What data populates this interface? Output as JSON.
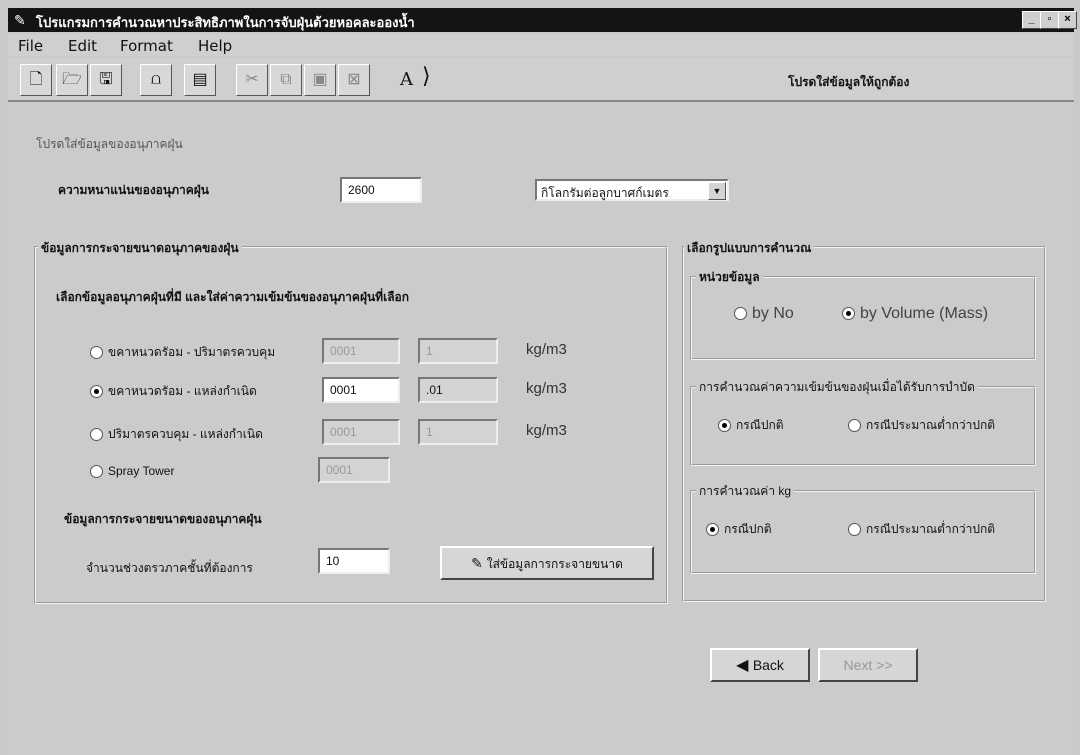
{
  "window": {
    "title": "โปรแกรมการคำนวณหาประสิทธิภาพในการจับฝุ่นด้วยหอคละอองน้ำ",
    "min": "_",
    "max": "▫",
    "close": "×"
  },
  "menu": [
    "File",
    "Edit",
    "Format",
    "Help"
  ],
  "toolbar": {
    "text_tool": "A",
    "status": "โปรดใส่ข้อมูลให้ถูกต้อง"
  },
  "main": {
    "header_label": "โปรดใส่ข้อมูลของอนุภาคฝุ่น",
    "density_label": "ความหนาแน่นของอนุภาคฝุ่น",
    "density_value": "2600",
    "density_unit": "กิโลกรัมต่อลูกบาศก์เมตร"
  },
  "distribution": {
    "legend": "ข้อมูลการกระจายขนาดอนุภาคของฝุ่น",
    "instruction": "เลือกข้อมูลอนุภาคฝุ่นที่มี และใส่ค่าความเข้มข้นของอนุภาคฝุ่นที่เลือก",
    "options": [
      {
        "label": "ขคาหนวดรัอม - ปริมาตรควบคุม",
        "value1": "0001",
        "value2": "1",
        "unit": "kg/m3"
      },
      {
        "label": "ขคาหนวดรัอม - แหล่งกำเนิด",
        "value1": "0001",
        "value2": ".01",
        "unit": "kg/m3"
      },
      {
        "label": "ปริมาตรควบคุม - แหล่งกำเนิด",
        "value1": "0001",
        "value2": "1",
        "unit": "kg/m3"
      },
      {
        "label": "Spray Tower",
        "value1": "0001"
      }
    ],
    "sub_label": "ข้อมูลการกระจายขนาดของอนุภาคฝุ่น",
    "count_label": "จำนวนช่วงตรวภาคชั้นที่ต้องการ",
    "count_value": "10",
    "enter_button": "ใส่ข้อมูลการกระจายขนาด"
  },
  "method": {
    "legend": "เลือกรูปแบบการคำนวณ",
    "unit_group": {
      "legend": "หน่วยข้อมูล",
      "opt1": "by No",
      "opt2": "by Volume (Mass)"
    },
    "conc_group": {
      "legend": "การคำนวณค่าความเข้มข้นของฝุ่นเมื่อได้รับการบำบัด",
      "opt1": "กรณีปกติ",
      "opt2": "กรณีประมาณต่ำกว่าปกติ"
    },
    "kg_group": {
      "legend": "การคำนวณค่า kg",
      "opt1": "กรณีปกติ",
      "opt2": "กรณีประมาณต่ำกว่าปกติ"
    }
  },
  "nav": {
    "back": "Back",
    "next": "Next >>"
  }
}
